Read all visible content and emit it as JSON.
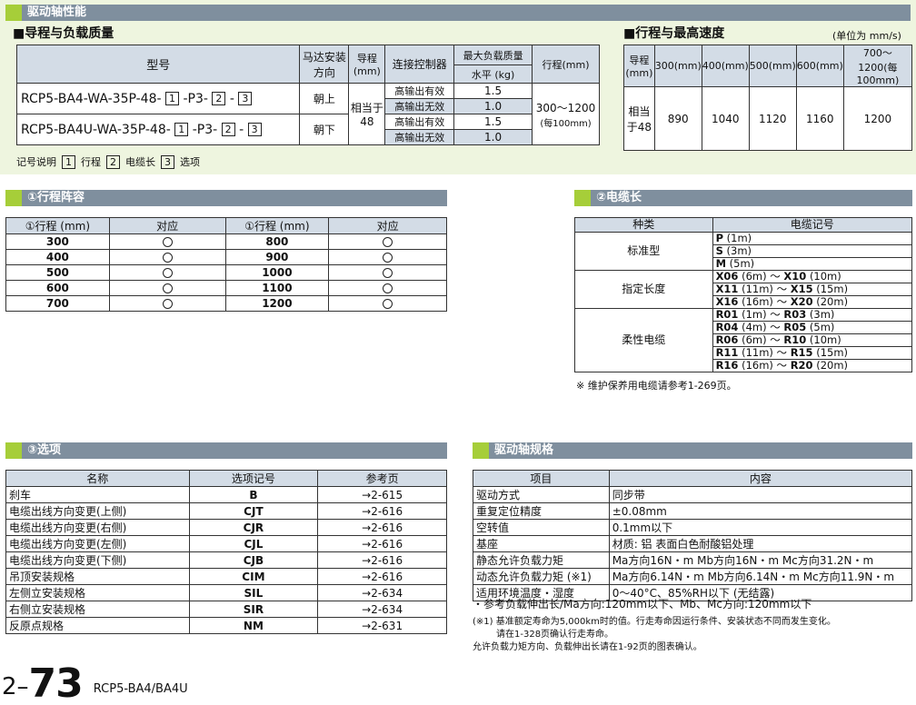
{
  "header_bar": "驱动轴性能",
  "lead_load": {
    "heading": "■导程与负载质量",
    "col_model": "型号",
    "col_motor": "马达安装方向",
    "col_lead": "导程(mm)",
    "col_ctrl": "连接控制器",
    "col_maxload": "最大负载质量",
    "col_horizontal": "水平 (kg)",
    "col_stroke": "行程(mm)",
    "rows": [
      {
        "model_prefix": "RCP5-BA4-WA-35P-48-",
        "box1": "1",
        "mid": "-P3-",
        "box2": "2",
        "dash": "-",
        "box3": "3",
        "motor": "朝上",
        "ctrl1": "高输出有效",
        "load1": "1.5",
        "ctrl2": "高输出无效",
        "load2": "1.0"
      },
      {
        "model_prefix": "RCP5-BA4U-WA-35P-48-",
        "box1": "1",
        "mid": "-P3-",
        "box2": "2",
        "dash": "-",
        "box3": "3",
        "motor": "朝下",
        "ctrl1": "高输出有效",
        "load1": "1.5",
        "ctrl2": "高输出无效",
        "load2": "1.0"
      }
    ],
    "lead_value": "相当于48",
    "stroke_value": "300〜1200",
    "stroke_note": "(每100mm)",
    "legend_label": "记号说明",
    "legend_items": [
      {
        "n": "1",
        "t": "行程"
      },
      {
        "n": "2",
        "t": "电缆长"
      },
      {
        "n": "3",
        "t": "选项"
      }
    ]
  },
  "speed": {
    "heading": "■行程与最高速度",
    "unit": "(单位为 mm/s)",
    "headers": [
      "导程(mm)",
      "300(mm)",
      "400(mm)",
      "500(mm)",
      "600(mm)",
      "700〜1200(每 100mm)"
    ],
    "lead": "相当于48",
    "values": [
      "890",
      "1040",
      "1120",
      "1160",
      "1200"
    ]
  },
  "stroke_table": {
    "title": "①行程阵容",
    "h1": "①行程 (mm)",
    "h2": "对应",
    "h3": "①行程 (mm)",
    "h4": "对应",
    "rows": [
      {
        "a": "300",
        "b": "800"
      },
      {
        "a": "400",
        "b": "900"
      },
      {
        "a": "500",
        "b": "1000"
      },
      {
        "a": "600",
        "b": "1100"
      },
      {
        "a": "700",
        "b": "1200"
      }
    ]
  },
  "cable": {
    "title": "②电缆长",
    "h1": "种类",
    "h2": "电缆记号",
    "std_label": "标准型",
    "std": [
      {
        "c": "P",
        "l": "(1m)"
      },
      {
        "c": "S",
        "l": "(3m)"
      },
      {
        "c": "M",
        "l": "(5m)"
      }
    ],
    "spec_label": "指定长度",
    "spec": [
      {
        "c1": "X06",
        "l1": "(6m)",
        "c2": "X10",
        "l2": "(10m)"
      },
      {
        "c1": "X11",
        "l1": "(11m)",
        "c2": "X15",
        "l2": "(15m)"
      },
      {
        "c1": "X16",
        "l1": "(16m)",
        "c2": "X20",
        "l2": "(20m)"
      }
    ],
    "flex_label": "柔性电缆",
    "flex": [
      {
        "c1": "R01",
        "l1": "(1m)",
        "c2": "R03",
        "l2": "(3m)"
      },
      {
        "c1": "R04",
        "l1": "(4m)",
        "c2": "R05",
        "l2": "(5m)"
      },
      {
        "c1": "R06",
        "l1": "(6m)",
        "c2": "R10",
        "l2": "(10m)"
      },
      {
        "c1": "R11",
        "l1": "(11m)",
        "c2": "R15",
        "l2": "(15m)"
      },
      {
        "c1": "R16",
        "l1": "(16m)",
        "c2": "R20",
        "l2": "(20m)"
      }
    ],
    "tilde": "〜",
    "note": "※ 维护保养用电缆请参考1-269页。"
  },
  "options": {
    "title": "③选项",
    "h1": "名称",
    "h2": "选项记号",
    "h3": "参考页",
    "rows": [
      {
        "name": "刹车",
        "code": "B",
        "page": "→2-615"
      },
      {
        "name": "电缆出线方向变更(上侧)",
        "code": "CJT",
        "page": "→2-616"
      },
      {
        "name": "电缆出线方向变更(右侧)",
        "code": "CJR",
        "page": "→2-616"
      },
      {
        "name": "电缆出线方向变更(左侧)",
        "code": "CJL",
        "page": "→2-616"
      },
      {
        "name": "电缆出线方向变更(下侧)",
        "code": "CJB",
        "page": "→2-616"
      },
      {
        "name": "吊顶安装规格",
        "code": "CIM",
        "page": "→2-616"
      },
      {
        "name": "左侧立安装规格",
        "code": "SIL",
        "page": "→2-634"
      },
      {
        "name": "右侧立安装规格",
        "code": "SIR",
        "page": "→2-634"
      },
      {
        "name": "反原点规格",
        "code": "NM",
        "page": "→2-631"
      }
    ]
  },
  "specs": {
    "title": "驱动轴规格",
    "h1": "项目",
    "h2": "内容",
    "rows": [
      {
        "k": "驱动方式",
        "v": "同步带"
      },
      {
        "k": "重复定位精度",
        "v": "±0.08mm"
      },
      {
        "k": "空转值",
        "v": "0.1mm以下"
      },
      {
        "k": "基座",
        "v": "材质: 铝  表面白色耐酸铝处理"
      },
      {
        "k": "静态允许负载力矩",
        "v": "Ma方向16N・m   Mb方向16N・m   Mc方向31.2N・m"
      },
      {
        "k": "动态允许负载力矩 (※1)",
        "v": "Ma方向6.14N・m   Mb方向6.14N・m   Mc方向11.9N・m"
      },
      {
        "k": "适用环境温度・湿度",
        "v": "0〜40°C、85%RH以下 (无结露)"
      }
    ],
    "note1": "・参考负载伸出长/Ma方向:120mm以下、Mb、Mc方向:120mm以下",
    "note2": "(※1) 基准额定寿命为5,000km时的值。行走寿命因运行条件、安装状态不同而发生变化。",
    "note3": "请在1-328页确认行走寿命。",
    "note4": "允许负载力矩方向、负载伸出长请在1-92页的图表确认。"
  },
  "footer": {
    "prefix": "2–",
    "page": "73",
    "model": "RCP5-BA4/BA4U"
  }
}
